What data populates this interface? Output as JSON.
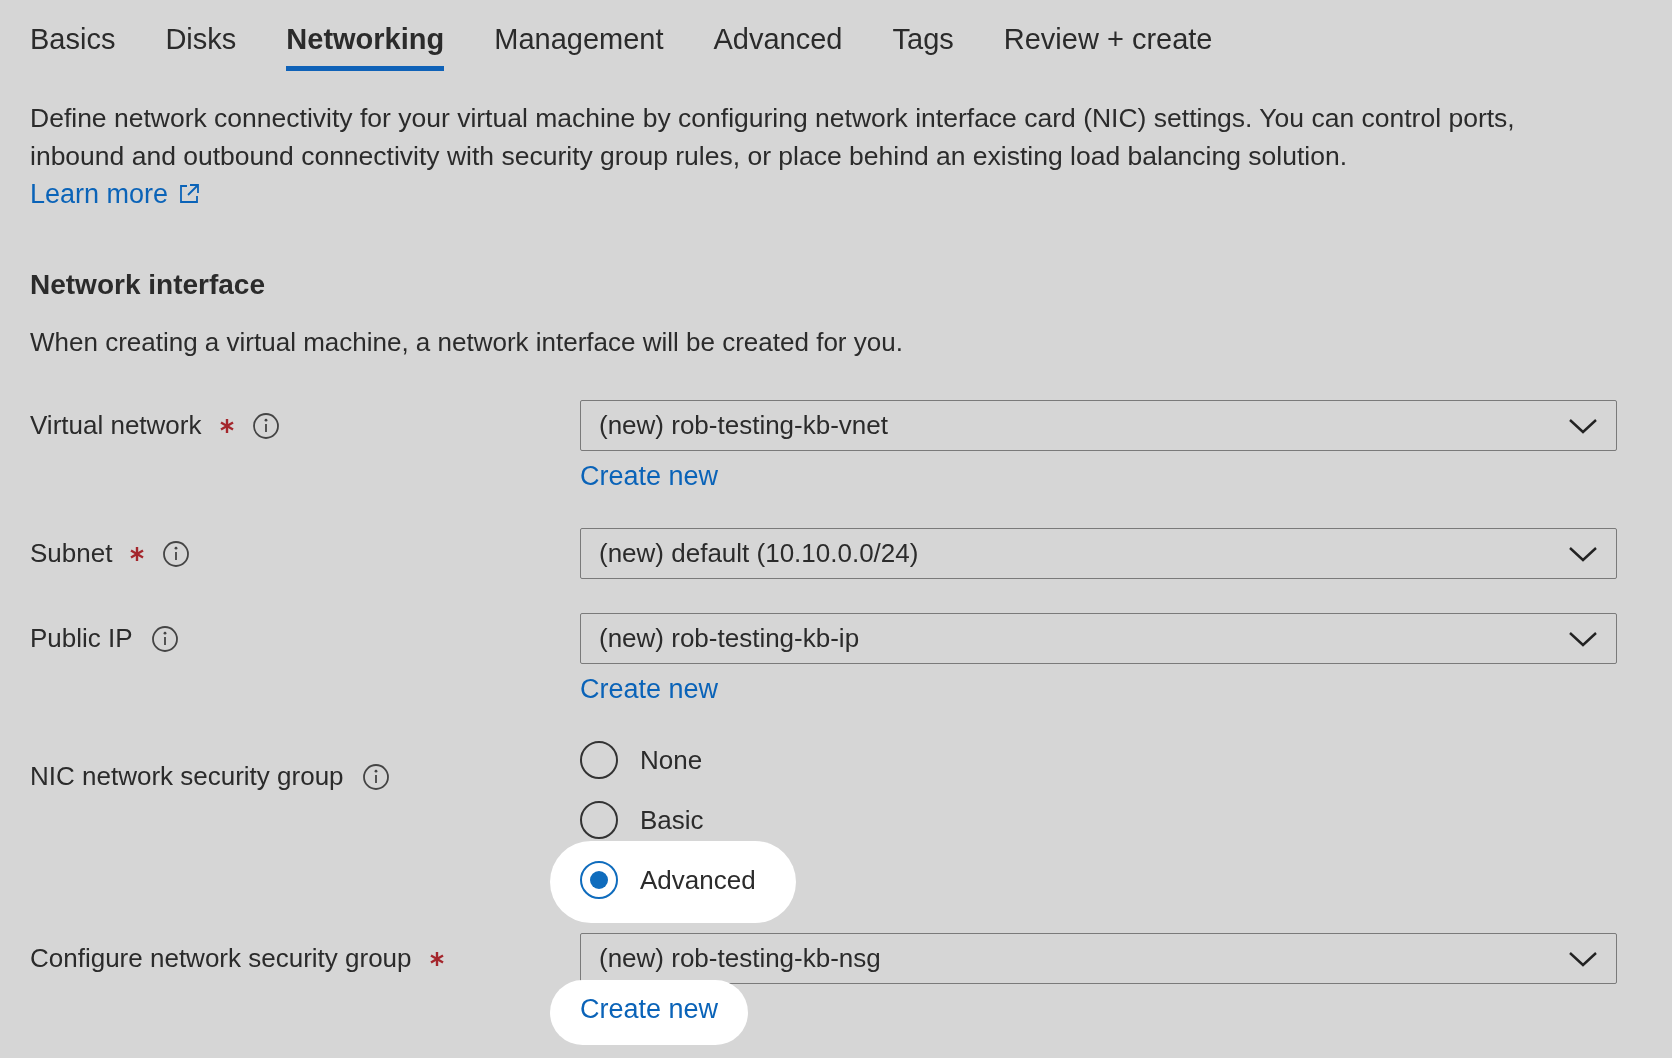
{
  "tabs": [
    {
      "label": "Basics",
      "selected": false
    },
    {
      "label": "Disks",
      "selected": false
    },
    {
      "label": "Networking",
      "selected": true
    },
    {
      "label": "Management",
      "selected": false
    },
    {
      "label": "Advanced",
      "selected": false
    },
    {
      "label": "Tags",
      "selected": false
    },
    {
      "label": "Review + create",
      "selected": false
    }
  ],
  "intro": {
    "text": "Define network connectivity for your virtual machine by configuring network interface card (NIC) settings. You can control ports, inbound and outbound connectivity with security group rules, or place behind an existing load balancing solution.",
    "link": "Learn more"
  },
  "section": {
    "title": "Network interface",
    "description": "When creating a virtual machine, a network interface will be created for you."
  },
  "fields": [
    {
      "kind": "dropdown",
      "label": "Virtual network",
      "required": true,
      "value": "(new) rob-testing-kb-vnet",
      "create_new": {
        "label": "Create new",
        "highlighted": false
      }
    },
    {
      "kind": "dropdown",
      "label": "Subnet",
      "required": true,
      "value": "(new) default (10.10.0.0/24)"
    },
    {
      "kind": "dropdown",
      "label": "Public IP",
      "required": false,
      "value": "(new) rob-testing-kb-ip",
      "create_new": {
        "label": "Create new",
        "highlighted": false
      }
    },
    {
      "kind": "radio",
      "label": "NIC network security group",
      "required": false,
      "options": [
        {
          "label": "None",
          "selected": false,
          "highlighted": false
        },
        {
          "label": "Basic",
          "selected": false,
          "highlighted": false
        },
        {
          "label": "Advanced",
          "selected": true,
          "highlighted": true
        }
      ]
    },
    {
      "kind": "dropdown",
      "label": "Configure network security group",
      "required": true,
      "info": false,
      "value": "(new) rob-testing-kb-nsg",
      "create_new": {
        "label": "Create new",
        "highlighted": true
      }
    }
  ]
}
